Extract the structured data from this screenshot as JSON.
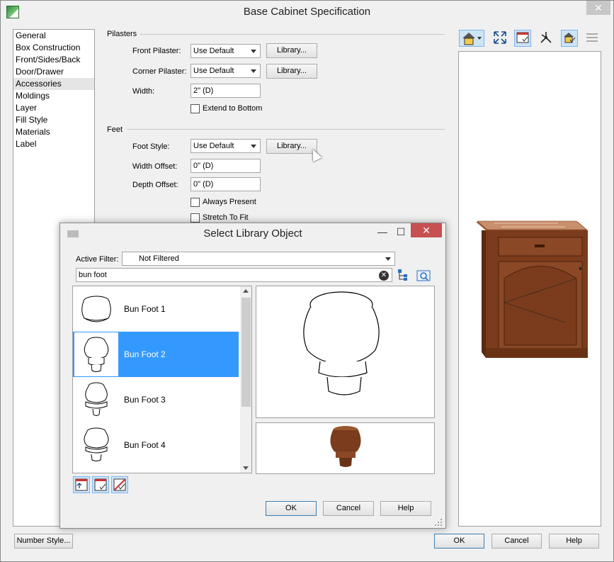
{
  "window": {
    "title": "Base Cabinet Specification",
    "close": "✕"
  },
  "sidebar": {
    "items": [
      {
        "label": "General"
      },
      {
        "label": "Box Construction"
      },
      {
        "label": "Front/Sides/Back"
      },
      {
        "label": "Door/Drawer"
      },
      {
        "label": "Accessories",
        "selected": true
      },
      {
        "label": "Moldings"
      },
      {
        "label": "Layer"
      },
      {
        "label": "Fill Style"
      },
      {
        "label": "Materials"
      },
      {
        "label": "Label"
      }
    ]
  },
  "pilasters": {
    "heading": "Pilasters",
    "front_label": "Front Pilaster:",
    "front_value": "Use Default",
    "corner_label": "Corner Pilaster:",
    "corner_value": "Use Default",
    "library_label": "Library...",
    "width_label": "Width:",
    "width_value": "2\" (D)",
    "extend_label": "Extend to Bottom"
  },
  "feet": {
    "heading": "Feet",
    "style_label": "Foot Style:",
    "style_value": "Use Default",
    "library_label": "Library...",
    "width_offset_label": "Width Offset:",
    "width_offset_value": "0\" (D)",
    "depth_offset_label": "Depth Offset:",
    "depth_offset_value": "0\" (D)",
    "always_present_label": "Always Present",
    "stretch_label": "Stretch To Fit"
  },
  "footer": {
    "number_style": "Number Style...",
    "ok": "OK",
    "cancel": "Cancel",
    "help": "Help"
  },
  "library_dialog": {
    "title": "Select Library Object",
    "filter_label": "Active Filter:",
    "filter_value": "Not Filtered",
    "search_value": "bun foot",
    "items": [
      {
        "label": "Bun Foot 1"
      },
      {
        "label": "Bun Foot 2",
        "selected": true
      },
      {
        "label": "Bun Foot 3"
      },
      {
        "label": "Bun Foot 4"
      }
    ],
    "ok": "OK",
    "cancel": "Cancel",
    "help": "Help",
    "minimize": "—",
    "maximize": "☐",
    "close": "✕"
  },
  "colors": {
    "accent": "#3399ff",
    "wood": "#7a3c1c",
    "close_red": "#c75050"
  }
}
